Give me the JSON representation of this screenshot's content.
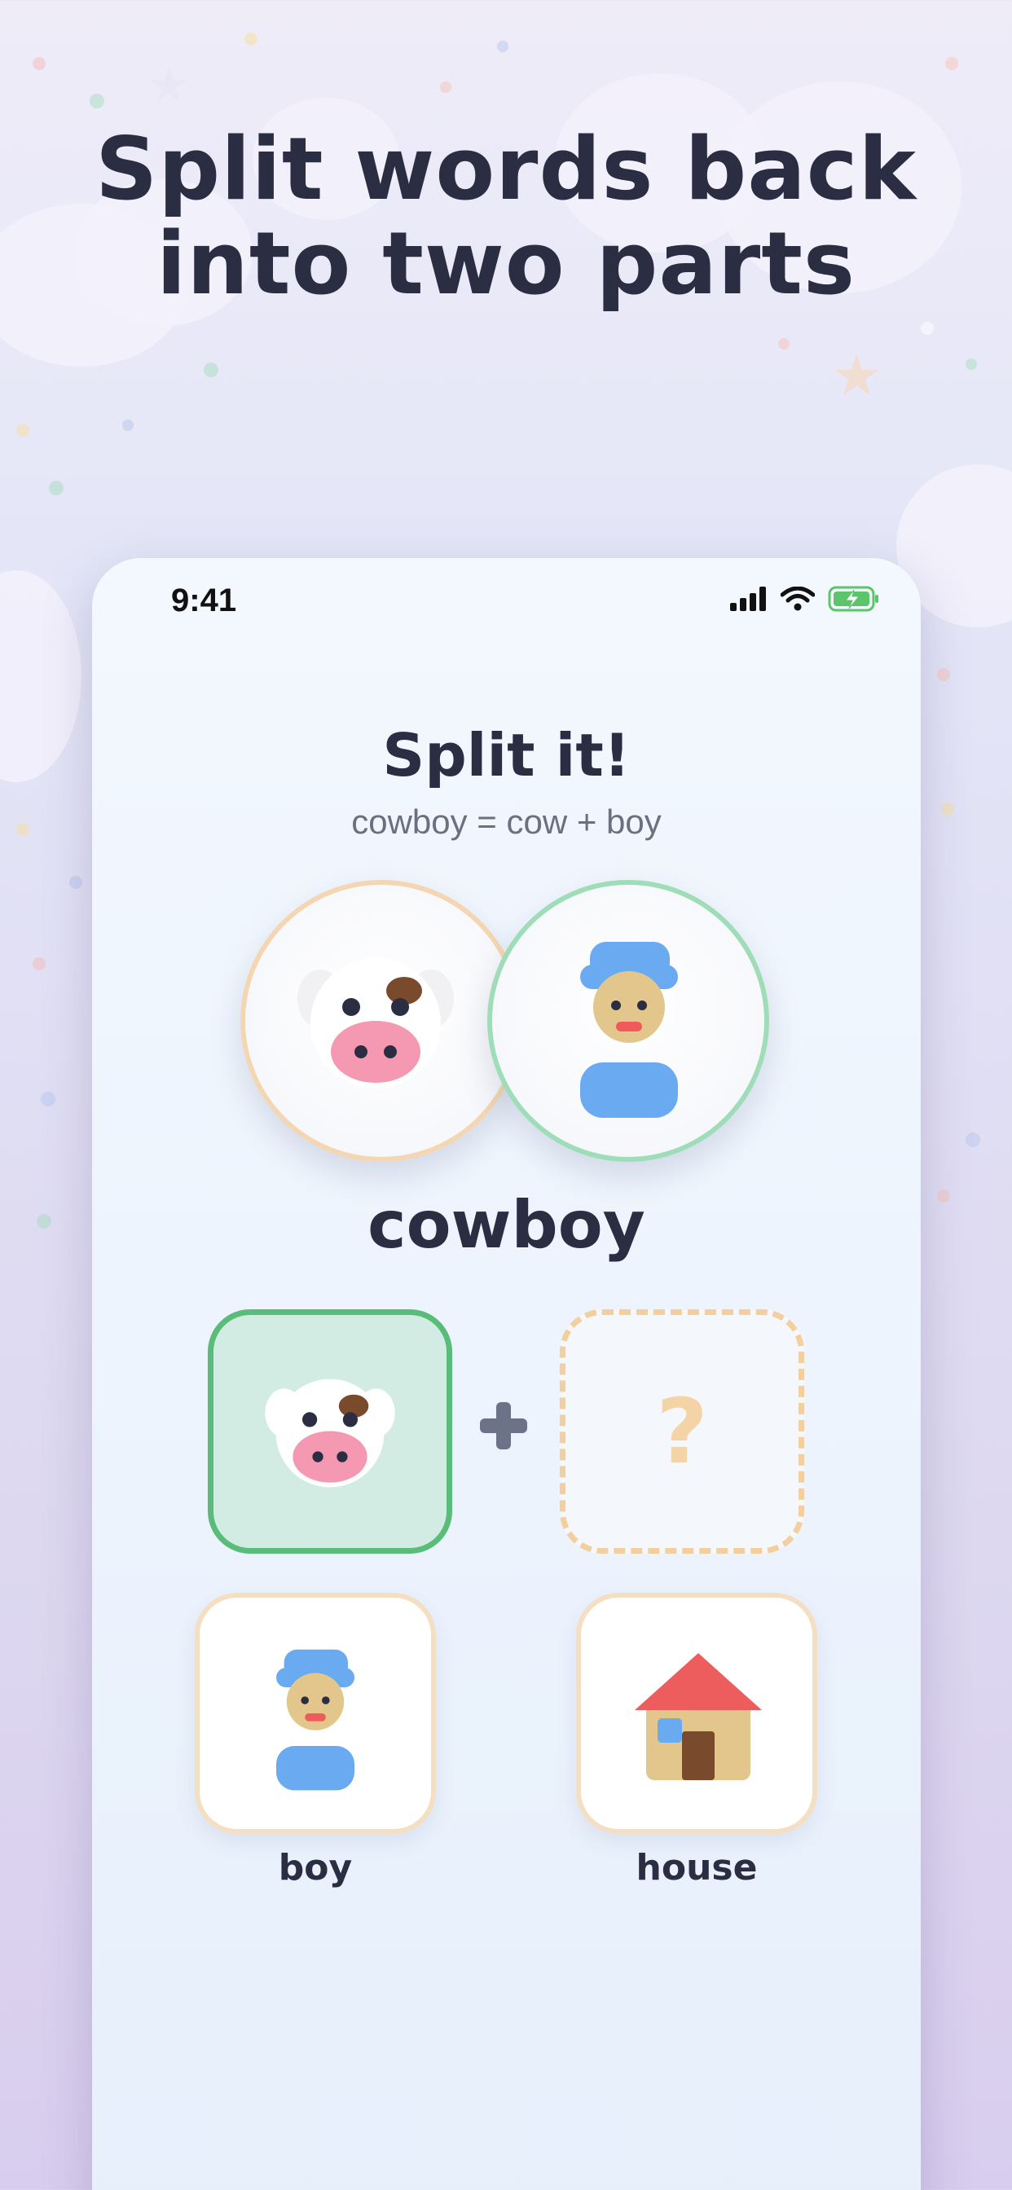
{
  "headline": {
    "line1": "Split words back",
    "line2": "into two parts"
  },
  "status_bar": {
    "time": "9:41",
    "icons": [
      "cellular-signal-icon",
      "wifi-icon",
      "battery-charging-icon"
    ]
  },
  "screen": {
    "title": "Split it!",
    "equation": "cowboy = cow + boy",
    "compound_images": [
      "cow-icon",
      "boy-icon"
    ],
    "word": "cowboy",
    "answer_slots": [
      {
        "state": "filled",
        "icon": "cow-icon"
      },
      {
        "state": "empty",
        "placeholder": "?"
      }
    ],
    "operator": "plus-icon",
    "options": [
      {
        "label": "boy",
        "icon": "boy-icon"
      },
      {
        "label": "house",
        "icon": "house-icon"
      }
    ]
  },
  "colors": {
    "headline_text": "#2b2d42",
    "correct_green": "#59bd79",
    "slot_peach": "#f2cf9d",
    "option_border": "#f5dfc3",
    "cow_circle_border": "#f5d6b2",
    "boy_circle_border": "#9fdcb8"
  }
}
